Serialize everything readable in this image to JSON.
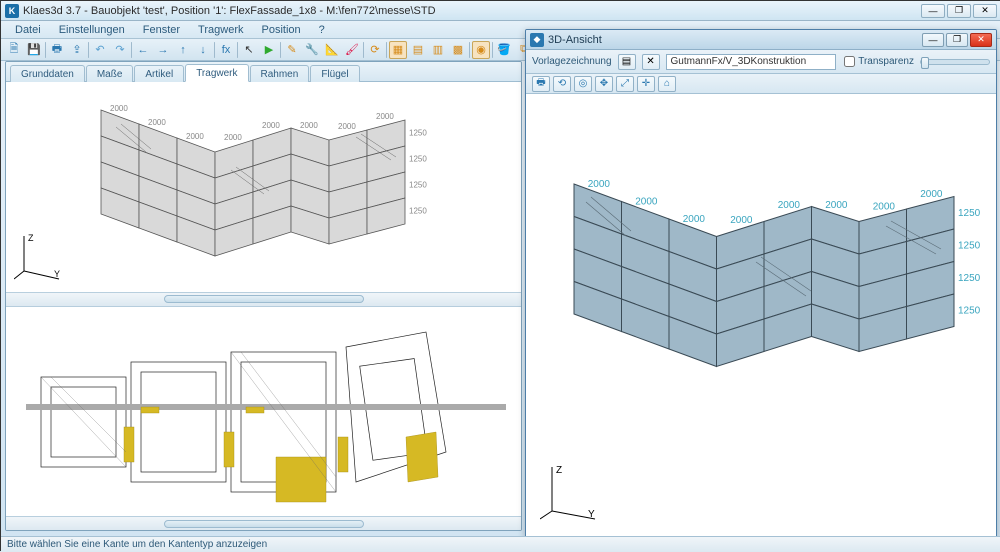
{
  "app": {
    "title": "Klaes3d 3.7 - Bauobjekt 'test', Position '1': FlexFassade_1x8 - M:\\fen772\\messe\\STD"
  },
  "winbuttons": {
    "min": "—",
    "max": "❐",
    "close": "✕"
  },
  "menubar": [
    "Datei",
    "Einstellungen",
    "Fenster",
    "Tragwerk",
    "Position",
    "?"
  ],
  "toolbar_icons": [
    "doc",
    "save",
    "sep",
    "print",
    "export",
    "sep",
    "undo",
    "redo",
    "sep",
    "arrow-l",
    "arrow-r",
    "arrow-u",
    "arrow-d",
    "sep",
    "fx",
    "sep",
    "cursor",
    "play",
    "sep",
    "pencil",
    "wrench",
    "ruler",
    "paint",
    "sep",
    "refresh",
    "sep",
    "grid1",
    "grid2",
    "grid3",
    "grid4",
    "sep",
    "view3d",
    "sep",
    "bucket",
    "copy",
    "paste"
  ],
  "toolbar_glyphs": {
    "doc": "🗎",
    "save": "💾",
    "print": "🖶",
    "export": "⇪",
    "undo": "↶",
    "redo": "↷",
    "arrow-l": "←",
    "arrow-r": "→",
    "arrow-u": "↑",
    "arrow-d": "↓",
    "fx": "fx",
    "cursor": "↖",
    "play": "▶",
    "pencil": "✎",
    "wrench": "🔧",
    "ruler": "📐",
    "paint": "🖌",
    "refresh": "⟳",
    "grid1": "▦",
    "grid2": "▤",
    "grid3": "▥",
    "grid4": "▩",
    "view3d": "◉",
    "bucket": "🪣",
    "copy": "⧉",
    "paste": "📋",
    "sep": ""
  },
  "toolbar_active": [
    "grid1",
    "view3d"
  ],
  "tabs": [
    "Grunddaten",
    "Maße",
    "Artikel",
    "Tragwerk",
    "Rahmen",
    "Flügel"
  ],
  "active_tab": "Tragwerk",
  "axes": {
    "z": "Z",
    "y": "Y"
  },
  "facade_labels": {
    "top": [
      "2000",
      "2000",
      "2000",
      "2000",
      "2000",
      "2000",
      "2000",
      "2000"
    ],
    "right": [
      "1250",
      "1250",
      "1250",
      "1250"
    ]
  },
  "child": {
    "title": "3D-Ansicht",
    "template_label": "Vorlagezeichnung",
    "path": "GutmannFx/V_3DKonstruktion",
    "transparency_label": "Transparenz",
    "toolbar2": [
      "print",
      "rotate",
      "orbit",
      "pan",
      "fit",
      "axis",
      "home"
    ],
    "toolbar2_glyphs": {
      "print": "🖶",
      "rotate": "⟲",
      "orbit": "◎",
      "pan": "✥",
      "fit": "⤢",
      "axis": "✛",
      "home": "⌂"
    }
  },
  "statusbar": "Bitte wählen Sie eine Kante um den Kantentyp anzuzeigen"
}
